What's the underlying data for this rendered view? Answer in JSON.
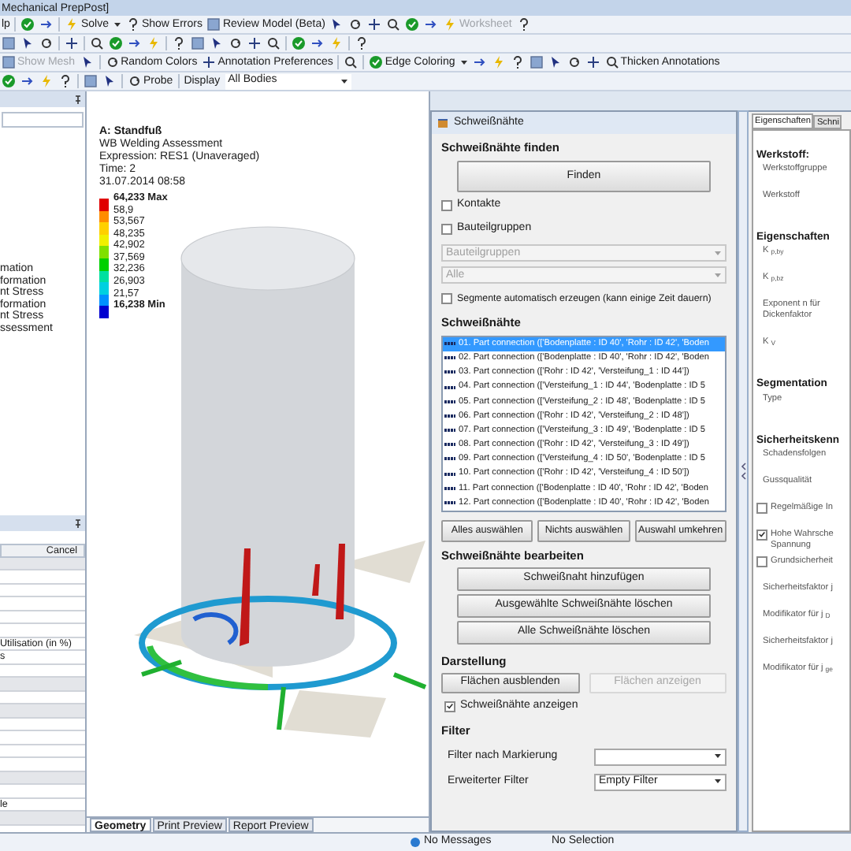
{
  "window": {
    "title": "Mechanical PrepPost]"
  },
  "toolbars": [
    [
      {
        "kind": "text",
        "label": "lp"
      },
      {
        "kind": "sep"
      },
      {
        "kind": "icon"
      },
      {
        "kind": "icon"
      },
      {
        "kind": "sep"
      },
      {
        "kind": "button",
        "label": "Solve",
        "dropdown": true
      },
      {
        "kind": "button",
        "label": "Show Errors"
      },
      {
        "kind": "button",
        "label": "Review Model (Beta)"
      },
      {
        "kind": "icon"
      },
      {
        "kind": "icon"
      },
      {
        "kind": "icon"
      },
      {
        "kind": "icon"
      },
      {
        "kind": "icon"
      },
      {
        "kind": "icon"
      },
      {
        "kind": "button",
        "label": "Worksheet",
        "disabled": true
      },
      {
        "kind": "icon"
      }
    ],
    [
      {
        "kind": "icon"
      },
      {
        "kind": "icon"
      },
      {
        "kind": "icon"
      },
      {
        "kind": "sep"
      },
      {
        "kind": "icon"
      },
      {
        "kind": "sep"
      },
      {
        "kind": "icon"
      },
      {
        "kind": "icon"
      },
      {
        "kind": "icon"
      },
      {
        "kind": "icon"
      },
      {
        "kind": "sep"
      },
      {
        "kind": "icon"
      },
      {
        "kind": "icon"
      },
      {
        "kind": "icon"
      },
      {
        "kind": "icon"
      },
      {
        "kind": "icon"
      },
      {
        "kind": "icon"
      },
      {
        "kind": "sep"
      },
      {
        "kind": "icon"
      },
      {
        "kind": "icon"
      },
      {
        "kind": "icon"
      },
      {
        "kind": "sep"
      },
      {
        "kind": "icon"
      }
    ],
    [
      {
        "kind": "button",
        "label": "Show Mesh",
        "disabled": true
      },
      {
        "kind": "icon"
      },
      {
        "kind": "sep"
      },
      {
        "kind": "button",
        "label": "Random Colors"
      },
      {
        "kind": "button",
        "label": "Annotation Preferences"
      },
      {
        "kind": "sep"
      },
      {
        "kind": "icon"
      },
      {
        "kind": "sep"
      },
      {
        "kind": "button",
        "label": "Edge Coloring",
        "dropdown": true
      },
      {
        "kind": "icon"
      },
      {
        "kind": "icon"
      },
      {
        "kind": "icon"
      },
      {
        "kind": "icon"
      },
      {
        "kind": "icon"
      },
      {
        "kind": "icon"
      },
      {
        "kind": "icon"
      },
      {
        "kind": "button",
        "label": "Thicken Annotations"
      }
    ],
    [
      {
        "kind": "icon"
      },
      {
        "kind": "icon"
      },
      {
        "kind": "icon"
      },
      {
        "kind": "icon"
      },
      {
        "kind": "sep"
      },
      {
        "kind": "icon"
      },
      {
        "kind": "icon"
      },
      {
        "kind": "sep"
      },
      {
        "kind": "button",
        "label": "Probe"
      },
      {
        "kind": "sep"
      },
      {
        "kind": "text",
        "label": "Display"
      },
      {
        "kind": "select",
        "label": "All Bodies"
      }
    ]
  ],
  "left_panel": {
    "tree_items": [
      "mation",
      "formation",
      "nt Stress",
      "formation",
      "nt Stress",
      "ssessment"
    ],
    "details_rows": [
      {
        "kind": "header",
        "text": "Cancel"
      },
      {
        "kind": "shaded",
        "text": ""
      },
      {
        "kind": "row",
        "text": ""
      },
      {
        "kind": "row",
        "text": ""
      },
      {
        "kind": "row",
        "text": ""
      },
      {
        "kind": "row",
        "text": ""
      },
      {
        "kind": "row",
        "text": ""
      },
      {
        "kind": "row",
        "text": "Utilisation (in %)"
      },
      {
        "kind": "row",
        "text": "s"
      },
      {
        "kind": "row",
        "text": ""
      },
      {
        "kind": "shaded",
        "text": ""
      },
      {
        "kind": "row",
        "text": ""
      },
      {
        "kind": "shaded",
        "text": ""
      },
      {
        "kind": "row",
        "text": ""
      },
      {
        "kind": "row",
        "text": ""
      },
      {
        "kind": "row",
        "text": ""
      },
      {
        "kind": "row",
        "text": ""
      },
      {
        "kind": "shaded",
        "text": ""
      },
      {
        "kind": "row",
        "text": ""
      },
      {
        "kind": "row",
        "text": "le"
      },
      {
        "kind": "shaded",
        "text": ""
      }
    ]
  },
  "graphics": {
    "title": "A: Standfuß",
    "lines": [
      "WB Welding Assessment",
      "Expression: RES1 (Unaveraged)",
      "Time: 2",
      "31.07.2014 08:58"
    ],
    "legend": [
      {
        "label": "64,233 Max",
        "color": "#e00000"
      },
      {
        "label": "58,9",
        "color": "#ff8c00"
      },
      {
        "label": "53,567",
        "color": "#ffd000"
      },
      {
        "label": "48,235",
        "color": "#f0f000"
      },
      {
        "label": "42,902",
        "color": "#80e000"
      },
      {
        "label": "37,569",
        "color": "#00d000"
      },
      {
        "label": "32,236",
        "color": "#00e0a0"
      },
      {
        "label": "26,903",
        "color": "#00d0e0"
      },
      {
        "label": "21,57",
        "color": "#0090ff"
      },
      {
        "label": "16,238 Min",
        "color": "#0000d0"
      }
    ],
    "tabs": [
      {
        "label": "Geometry",
        "selected": true
      },
      {
        "label": "Print Preview",
        "selected": false
      },
      {
        "label": "Report Preview",
        "selected": false
      }
    ]
  },
  "dialog": {
    "title": "Schweißnähte",
    "find": {
      "heading": "Schweißnähte finden",
      "button": "Finden",
      "checks": [
        {
          "label": "Kontakte",
          "checked": false
        },
        {
          "label": "Bauteilgruppen",
          "checked": false
        }
      ],
      "selects": [
        "Bauteilgruppen",
        "Alle"
      ],
      "auto": {
        "label": "Segmente automatisch erzeugen (kann einige Zeit dauern)",
        "checked": false
      }
    },
    "welds": {
      "heading": "Schweißnähte",
      "items": [
        {
          "label": "01. Part connection (['Bodenplatte : ID 40', 'Rohr : ID 42', 'Boden",
          "selected": true
        },
        {
          "label": "02. Part connection (['Bodenplatte : ID 40', 'Rohr : ID 42', 'Boden",
          "selected": false
        },
        {
          "label": "03. Part connection (['Rohr : ID 42', 'Versteifung_1 : ID 44'])",
          "selected": false
        },
        {
          "label": "04. Part connection (['Versteifung_1 : ID 44', 'Bodenplatte : ID 5",
          "selected": false
        },
        {
          "label": "05. Part connection (['Versteifung_2 : ID 48', 'Bodenplatte : ID 5",
          "selected": false
        },
        {
          "label": "06. Part connection (['Rohr : ID 42', 'Versteifung_2 : ID 48'])",
          "selected": false
        },
        {
          "label": "07. Part connection (['Versteifung_3 : ID 49', 'Bodenplatte : ID 5",
          "selected": false
        },
        {
          "label": "08. Part connection (['Rohr : ID 42', 'Versteifung_3 : ID 49'])",
          "selected": false
        },
        {
          "label": "09. Part connection (['Versteifung_4 : ID 50', 'Bodenplatte : ID 5",
          "selected": false
        },
        {
          "label": "10. Part connection (['Rohr : ID 42', 'Versteifung_4 : ID 50'])",
          "selected": false
        },
        {
          "label": "11. Part connection (['Bodenplatte : ID 40', 'Rohr : ID 42', 'Boden",
          "selected": false
        },
        {
          "label": "12. Part connection (['Bodenplatte : ID 40', 'Rohr : ID 42', 'Boden",
          "selected": false
        }
      ],
      "buttons": [
        "Alles auswählen",
        "Nichts auswählen",
        "Auswahl umkehren"
      ]
    },
    "edit": {
      "heading": "Schweißnähte bearbeiten",
      "buttons": [
        "Schweißnaht hinzufügen",
        "Ausgewählte Schweißnähte löschen",
        "Alle Schweißnähte löschen"
      ]
    },
    "display": {
      "heading": "Darstellung",
      "buttons": [
        {
          "label": "Flächen ausblenden",
          "disabled": false
        },
        {
          "label": "Flächen anzeigen",
          "disabled": true
        }
      ],
      "check": {
        "label": "Schweißnähte anzeigen",
        "checked": true
      }
    },
    "filter": {
      "heading": "Filter",
      "rows": [
        {
          "label": "Filter nach Markierung",
          "value": ""
        },
        {
          "label": "Erweiterter Filter",
          "value": "Empty Filter"
        }
      ]
    }
  },
  "properties": {
    "tabs": [
      {
        "label": "Eigenschaften",
        "selected": true
      },
      {
        "label": "Schni",
        "selected": false
      }
    ],
    "items": [
      {
        "kind": "heading",
        "text": "Werkstoff:"
      },
      {
        "kind": "label",
        "text": "Werkstoffgruppe"
      },
      {
        "kind": "label",
        "text": "Werkstoff"
      },
      {
        "kind": "heading",
        "text": "Eigenschaften"
      },
      {
        "kind": "label",
        "text": "K $_{p,by}$"
      },
      {
        "kind": "label",
        "text": "K $_{p,bz}$"
      },
      {
        "kind": "label",
        "text": "Exponent n für Dickenfaktor"
      },
      {
        "kind": "label",
        "text": "K $_{V}$"
      },
      {
        "kind": "heading",
        "text": "Segmentation"
      },
      {
        "kind": "label",
        "text": "Type"
      },
      {
        "kind": "heading",
        "text": "Sicherheitskenn"
      },
      {
        "kind": "label",
        "text": "Schadensfolgen"
      },
      {
        "kind": "label",
        "text": "Gussqualität"
      },
      {
        "kind": "checkbox",
        "text": "Regelmäßige In",
        "checked": false
      },
      {
        "kind": "checkbox",
        "text": "Hohe Wahrsche Spannung",
        "checked": true
      },
      {
        "kind": "checkbox",
        "text": "Grundsicherheit",
        "checked": false
      },
      {
        "kind": "label",
        "text": "Sicherheitsfaktor j"
      },
      {
        "kind": "label",
        "text": "Modifikator für j $_{D}$"
      },
      {
        "kind": "label",
        "text": "Sicherheitsfaktor j"
      },
      {
        "kind": "label",
        "text": "Modifikator für j $_{ge}$"
      }
    ]
  },
  "status_bar": [
    "No Messages",
    "No Selection"
  ]
}
